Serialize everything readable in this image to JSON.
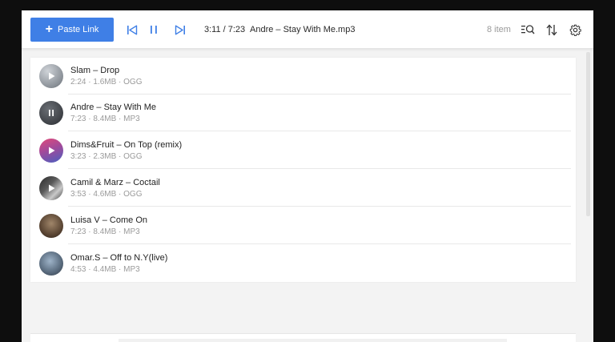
{
  "toolbar": {
    "paste_label": "Paste Link",
    "time": "3:11 / 7:23",
    "now_playing": "Andre – Stay With Me.mp3",
    "item_count": "8 item",
    "accent_color": "#3f7fe6",
    "icons": [
      "skip-previous-icon",
      "pause-icon",
      "skip-next-icon",
      "search-list-icon",
      "sort-icon",
      "gear-icon"
    ]
  },
  "tracks": [
    {
      "title": "Slam – Drop",
      "meta": "2:24 · 1.6MB · OGG",
      "state": "play"
    },
    {
      "title": "Andre – Stay With Me",
      "meta": "7:23 · 8.4MB · MP3",
      "state": "pause"
    },
    {
      "title": "Dims&Fruit – On Top (remix)",
      "meta": "3:23 · 2.3MB · OGG",
      "state": "play"
    },
    {
      "title": "Camil & Marz – Coctail",
      "meta": "3:53 · 4.6MB · OGG",
      "state": "play"
    },
    {
      "title": "Luisa V – Come On",
      "meta": "7:23 · 8.4MB · MP3",
      "state": "none"
    },
    {
      "title": "Omar.S – Off to N.Y(live)",
      "meta": "4:53 · 4.4MB · MP3",
      "state": "none"
    }
  ]
}
